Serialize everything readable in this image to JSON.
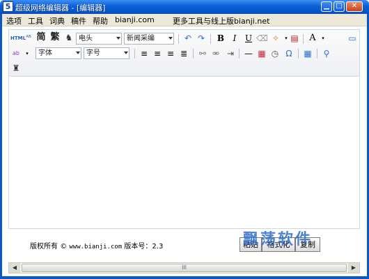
{
  "window": {
    "title": "超级网络编辑器 - [编辑器]",
    "app_icon_glyph": "5"
  },
  "menu": [
    "选项",
    "工具",
    "词典",
    "稿件",
    "帮助",
    "bianji.com",
    "更多工具与线上版bianji.net"
  ],
  "toolbar": {
    "html_label": "HTML",
    "simplified_label": "简",
    "traditional_label": "繁",
    "headline_select": "电头",
    "category_select": "新闻采编",
    "bold": "B",
    "italic": "I",
    "underline": "U",
    "font_size_icon": "A",
    "font_select": "字体",
    "size_select": "字号",
    "omega": "Ω"
  },
  "footer": {
    "copyright_label": "版权所有",
    "copyright_symbol": "©",
    "site": "www.bianji.com",
    "version_label": "版本号：2.3",
    "paste_button": "粘贴",
    "format_button": "格式化",
    "copy_button": "复制"
  },
  "watermark": "飘荡软件",
  "scrollbar": {
    "grip": "III"
  }
}
